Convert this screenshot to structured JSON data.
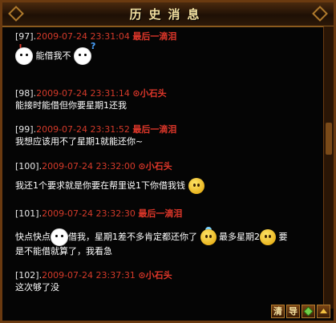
{
  "window": {
    "title": "历史消息"
  },
  "entries": [
    {
      "index": "[97].",
      "time": "2009-07-24 23:31:04",
      "name": "最后一滴泪",
      "text": "能借我不"
    },
    {
      "index": "[98].",
      "time": "2009-07-24 23:31:14",
      "name": "⊙小石头",
      "text": "能接时能借但你要星期1还我"
    },
    {
      "index": "[99].",
      "time": "2009-07-24 23:31:52",
      "name": "最后一滴泪",
      "text": "我想应该用不了星期1就能还你~"
    },
    {
      "index": "[100].",
      "time": "2009-07-24 23:32:00",
      "name": "⊙小石头",
      "text": "我还1个要求就是你要在帮里说1下你借我钱"
    },
    {
      "index": "[101].",
      "time": "2009-07-24 23:32:30",
      "name": "最后一滴泪",
      "text_a": "快点快点",
      "text_b": "借我，星期1差不多肯定都还你了",
      "text_c": "最多星期2",
      "text_d": "要",
      "text_e": "是不能借就算了，我看急"
    },
    {
      "index": "[102].",
      "time": "2009-07-24 23:37:31",
      "name": "⊙小石头",
      "text": "这次够了没"
    }
  ],
  "buttons": {
    "clear": "清",
    "export": "导"
  },
  "emoticons": [
    "bunny-exclaim-icon",
    "bunny-question-icon",
    "thinking-face-icon",
    "cat-face-icon",
    "angel-face-icon",
    "grin-face-icon"
  ]
}
